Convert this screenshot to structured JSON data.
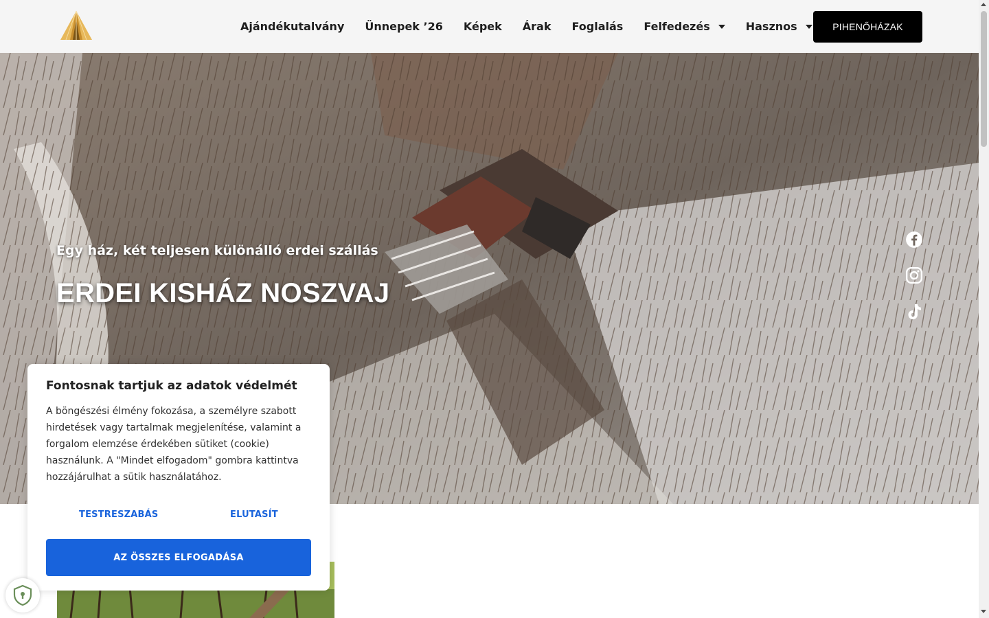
{
  "header": {
    "logo_name": "pyramid-logo",
    "nav": [
      {
        "label": "Ajándékutalvány",
        "has_dropdown": false
      },
      {
        "label": "Ünnepek ’26",
        "has_dropdown": false
      },
      {
        "label": "Képek",
        "has_dropdown": false
      },
      {
        "label": "Árak",
        "has_dropdown": false
      },
      {
        "label": "Foglalás",
        "has_dropdown": false
      },
      {
        "label": "Felfedezés",
        "has_dropdown": true
      },
      {
        "label": "Hasznos",
        "has_dropdown": true
      }
    ],
    "cta_label": "PIHENŐHÁZAK"
  },
  "hero": {
    "subtitle": "Egy ház, két teljesen különálló erdei szállás",
    "title": "ERDEI KISHÁZ NOSZVAJ",
    "social": [
      "facebook-icon",
      "instagram-icon",
      "tiktok-icon"
    ]
  },
  "cookie": {
    "title": "Fontosnak tartjuk az adatok védelmét",
    "text": "A böngészési élmény fokozása, a személyre szabott hirdetések vagy tartalmak megjelenítése, valamint a forgalom elemzése érdekében sütiket (cookie) használunk. A \"Mindet elfogadom\" gombra kattintva hozzájárulhat a sütik használatához.",
    "customize_label": "TESTRESZABÁS",
    "reject_label": "ELUTASÍT",
    "accept_label": "AZ ÖSSZES ELFOGADÁSA"
  },
  "colors": {
    "accent_blue": "#1863dc",
    "cta_black": "#000000",
    "logo_gold": "#d9a441"
  }
}
